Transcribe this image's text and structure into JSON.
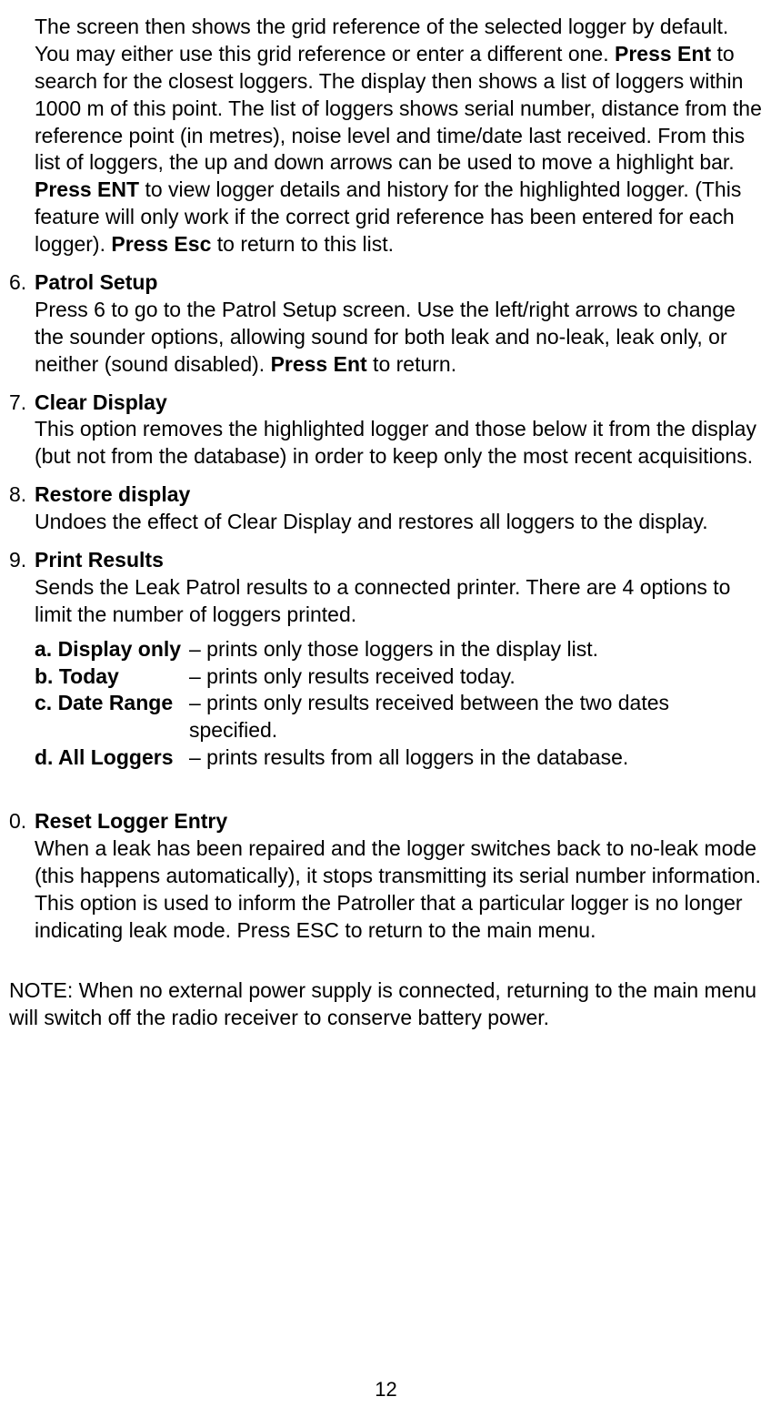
{
  "intro": {
    "p1a": "The screen then shows the grid reference of the selected logger by default.  You may either use this grid reference or enter a different one. ",
    "p1b": "Press Ent",
    "p1c": " to search for the closest loggers. The display then shows a list of loggers within 1000 m of this point. The list of loggers shows serial number, distance from the reference point (in metres), noise level and time/date last received. From this list of loggers, the up and down arrows can be used to move a highlight bar. ",
    "p1d": "Press ENT",
    "p1e": " to view logger details and history for the highlighted logger.  (This feature will only work if the correct grid reference has been entered for each logger).  ",
    "p1f": "Press Esc",
    "p1g": " to return to this list."
  },
  "item6": {
    "num": "6.",
    "title": "Patrol Setup",
    "body_a": "Press 6 to go to the Patrol Setup screen.  Use the left/right arrows to change the sounder options, allowing sound for both leak and no-leak, leak only, or neither (sound disabled).  ",
    "body_b": "Press Ent",
    "body_c": " to return."
  },
  "item7": {
    "num": "7.",
    "title": "Clear Display",
    "body": "This option removes the highlighted logger and those below it from the display (but not from the database) in order to keep only the most recent acquisitions."
  },
  "item8": {
    "num": "8.",
    "title": "Restore display",
    "body": "Undoes the effect of Clear Display and restores all loggers to the display."
  },
  "item9": {
    "num": "9.",
    "title": "Print Results",
    "body": "Sends the Leak Patrol results to a connected printer. There are 4 options to limit the number of loggers printed.",
    "opts": {
      "a_label": "a. Display only",
      "a_desc": "– prints only those loggers in the display list.",
      "b_label": "b. Today",
      "b_desc": "– prints only results received today.",
      "c_label": "c. Date Range",
      "c_desc": "– prints only results received between the two dates specified.",
      "d_label": "d. All Loggers",
      "d_desc": "– prints results from all loggers in the database."
    }
  },
  "item0": {
    "num": "0.",
    "title": "Reset Logger Entry",
    "body": "When a leak has been repaired and the logger switches back to no-leak mode (this happens automatically), it stops transmitting its serial number information. This option is used to inform the Patroller that a particular logger is no longer indicating leak mode. Press ESC to return to the main menu."
  },
  "note": "NOTE: When no external power supply is connected, returning to the main menu will switch off the radio receiver to conserve battery power.",
  "page": "12"
}
